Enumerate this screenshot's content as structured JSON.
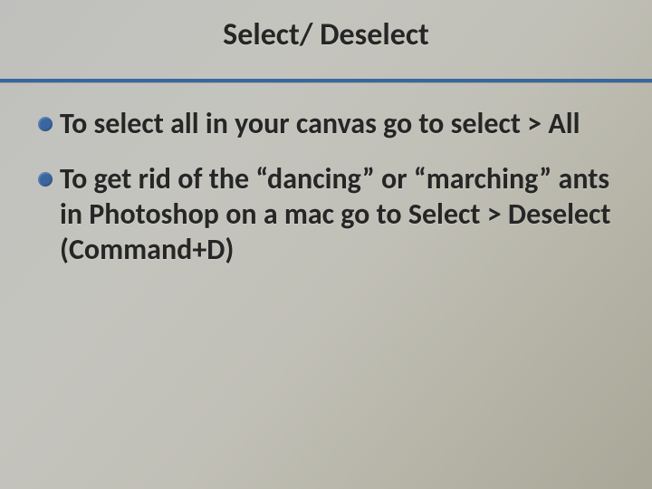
{
  "slide": {
    "title": "Select/ Deselect",
    "bullets": [
      "To select all in your canvas go to select > All",
      "To get rid of the “dancing” or “marching” ants in Photoshop on a mac go to Select > Deselect (Command+D)"
    ]
  },
  "colors": {
    "accent": "#3a66a0"
  }
}
